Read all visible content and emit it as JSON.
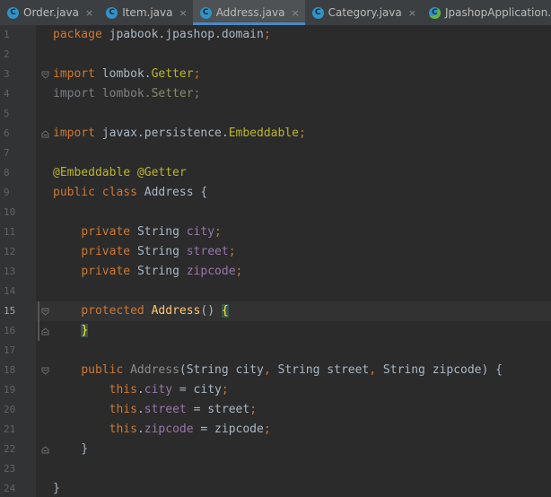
{
  "tabs": [
    {
      "label": "Order.java",
      "icon": "C",
      "icon_name": "java-class-icon",
      "active": false
    },
    {
      "label": "Item.java",
      "icon": "C",
      "icon_name": "java-class-icon",
      "active": false
    },
    {
      "label": "Address.java",
      "icon": "C",
      "icon_name": "java-class-icon",
      "active": true
    },
    {
      "label": "Category.java",
      "icon": "C",
      "icon_name": "java-class-icon",
      "active": false
    },
    {
      "label": "JpashopApplication.java",
      "icon": "C",
      "icon_name": "spring-app-class-icon",
      "active": false
    }
  ],
  "close_glyph": "×",
  "colors": {
    "background": "#2b2b2b",
    "keyword": "#cc7832",
    "annotation": "#bbb529",
    "field": "#9876aa",
    "method": "#ffc66d",
    "text": "#a9b7c6",
    "tab_active_underline": "#4a88c7"
  },
  "editor": {
    "current_line": 15,
    "lines": [
      {
        "n": "1",
        "tokens": [
          [
            "kw",
            "package "
          ],
          [
            "pkg",
            "jpabook.jpashop.domain"
          ],
          [
            "kw",
            ";"
          ]
        ]
      },
      {
        "n": "2",
        "tokens": []
      },
      {
        "n": "3",
        "fold": "open",
        "tokens": [
          [
            "kw",
            "import "
          ],
          [
            "pkg",
            "lombok."
          ],
          [
            "ann",
            "Getter"
          ],
          [
            "kw",
            ";"
          ]
        ]
      },
      {
        "n": "4",
        "tokens": [
          [
            "dimkw",
            "import "
          ],
          [
            "dim",
            "lombok."
          ],
          [
            "dimcls",
            "Setter"
          ],
          [
            "dimkw",
            ";"
          ]
        ]
      },
      {
        "n": "5",
        "tokens": []
      },
      {
        "n": "6",
        "fold": "close",
        "tokens": [
          [
            "kw",
            "import "
          ],
          [
            "pkg",
            "javax.persistence."
          ],
          [
            "ann",
            "Embeddable"
          ],
          [
            "kw",
            ";"
          ]
        ]
      },
      {
        "n": "7",
        "tokens": []
      },
      {
        "n": "8",
        "tokens": [
          [
            "ann",
            "@Embeddable"
          ],
          [
            "plain",
            " "
          ],
          [
            "ann",
            "@Getter"
          ]
        ]
      },
      {
        "n": "9",
        "tokens": [
          [
            "kw",
            "public class "
          ],
          [
            "cls",
            "Address "
          ],
          [
            "plain",
            "{"
          ]
        ]
      },
      {
        "n": "10",
        "tokens": []
      },
      {
        "n": "11",
        "tokens": [
          [
            "plain",
            "    "
          ],
          [
            "kw",
            "private "
          ],
          [
            "cls",
            "String "
          ],
          [
            "field",
            "city"
          ],
          [
            "kw",
            ";"
          ]
        ]
      },
      {
        "n": "12",
        "tokens": [
          [
            "plain",
            "    "
          ],
          [
            "kw",
            "private "
          ],
          [
            "cls",
            "String "
          ],
          [
            "field",
            "street"
          ],
          [
            "kw",
            ";"
          ]
        ]
      },
      {
        "n": "13",
        "tokens": [
          [
            "plain",
            "    "
          ],
          [
            "kw",
            "private "
          ],
          [
            "cls",
            "String "
          ],
          [
            "field",
            "zipcode"
          ],
          [
            "kw",
            ";"
          ]
        ]
      },
      {
        "n": "14",
        "tokens": []
      },
      {
        "n": "15",
        "fold": "open",
        "marker": true,
        "tokens": [
          [
            "plain",
            "    "
          ],
          [
            "kw",
            "protected "
          ],
          [
            "method",
            "Address"
          ],
          [
            "plain",
            "() "
          ],
          [
            "brace-hl",
            "{"
          ]
        ]
      },
      {
        "n": "16",
        "fold": "close",
        "marker": true,
        "tokens": [
          [
            "plain",
            "    "
          ],
          [
            "brace-hl",
            "}"
          ]
        ]
      },
      {
        "n": "17",
        "tokens": []
      },
      {
        "n": "18",
        "fold": "open",
        "tokens": [
          [
            "plain",
            "    "
          ],
          [
            "kw",
            "public "
          ],
          [
            "ctor-gray",
            "Address"
          ],
          [
            "plain",
            "("
          ],
          [
            "cls",
            "String "
          ],
          [
            "plain",
            "city"
          ],
          [
            "kw",
            ", "
          ],
          [
            "cls",
            "String "
          ],
          [
            "plain",
            "street"
          ],
          [
            "kw",
            ", "
          ],
          [
            "cls",
            "String "
          ],
          [
            "plain",
            "zipcode) {"
          ]
        ]
      },
      {
        "n": "19",
        "tokens": [
          [
            "plain",
            "        "
          ],
          [
            "kw",
            "this"
          ],
          [
            "plain",
            "."
          ],
          [
            "field",
            "city "
          ],
          [
            "plain",
            "= city"
          ],
          [
            "kw",
            ";"
          ]
        ]
      },
      {
        "n": "20",
        "tokens": [
          [
            "plain",
            "        "
          ],
          [
            "kw",
            "this"
          ],
          [
            "plain",
            "."
          ],
          [
            "field",
            "street "
          ],
          [
            "plain",
            "= street"
          ],
          [
            "kw",
            ";"
          ]
        ]
      },
      {
        "n": "21",
        "tokens": [
          [
            "plain",
            "        "
          ],
          [
            "kw",
            "this"
          ],
          [
            "plain",
            "."
          ],
          [
            "field",
            "zipcode "
          ],
          [
            "plain",
            "= zipcode"
          ],
          [
            "kw",
            ";"
          ]
        ]
      },
      {
        "n": "22",
        "fold": "close",
        "tokens": [
          [
            "plain",
            "    }"
          ]
        ]
      },
      {
        "n": "23",
        "tokens": []
      },
      {
        "n": "24",
        "tokens": [
          [
            "plain",
            "}"
          ]
        ]
      }
    ]
  }
}
